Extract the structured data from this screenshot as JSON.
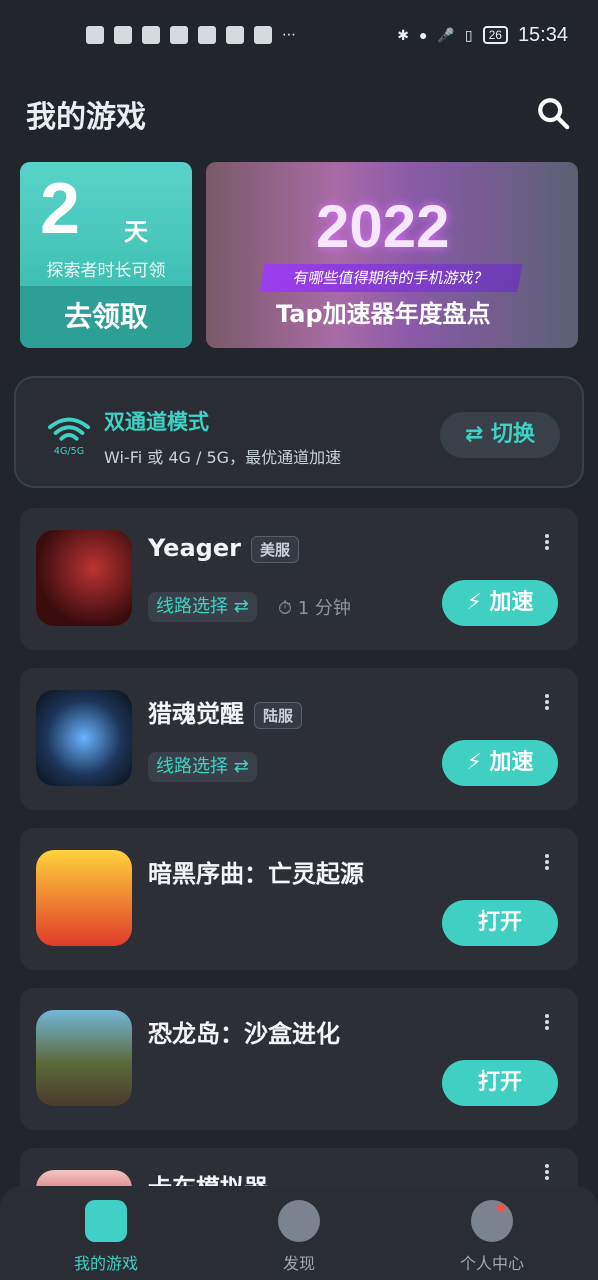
{
  "statusbar": {
    "left_icons": [
      "notification-icon",
      "wifi-icon",
      "video-icon",
      "app-icon",
      "shield-icon",
      "globe-icon",
      "qq-icon",
      "more-icon"
    ],
    "right_icons": [
      "bluetooth-icon",
      "location-icon",
      "mic-icon",
      "vibrate-icon"
    ],
    "battery": "26",
    "time": "15:34"
  },
  "page": {
    "title": "我的游戏"
  },
  "reward": {
    "days": "2",
    "unit": "天",
    "desc": "探索者时长可领",
    "claim": "去领取"
  },
  "banner": {
    "year": "2022",
    "question": "有哪些值得期待的手机游戏？",
    "slogan": "Tap加速器年度盘点"
  },
  "dual_channel": {
    "title": "双通道模式",
    "subtitle": "Wi-Fi 或 4G / 5G，最优通道加速",
    "wifi_label": "4G/5G",
    "switch_label": "⇄ 切换"
  },
  "games": [
    {
      "name": "Yeager",
      "badge": "美服",
      "route": "线路选择 ⇄",
      "timer": "⏱ 1 分钟",
      "action": "⚡ 加速"
    },
    {
      "name": "猎魂觉醒",
      "badge": "陆服",
      "route": "线路选择 ⇄",
      "action": "⚡ 加速"
    },
    {
      "name": "暗黑序曲：亡灵起源",
      "action": "打开"
    },
    {
      "name": "恐龙岛：沙盒进化",
      "action": "打开"
    }
  ],
  "partial_game": {
    "name": "卡车模拟器"
  },
  "bottom_nav": [
    {
      "label": "我的游戏",
      "active": true
    },
    {
      "label": "发现",
      "active": false
    },
    {
      "label": "个人中心",
      "active": false
    }
  ],
  "colors": {
    "accent": "#3fd1c5",
    "background": "#22262c",
    "card": "#2c3036"
  }
}
